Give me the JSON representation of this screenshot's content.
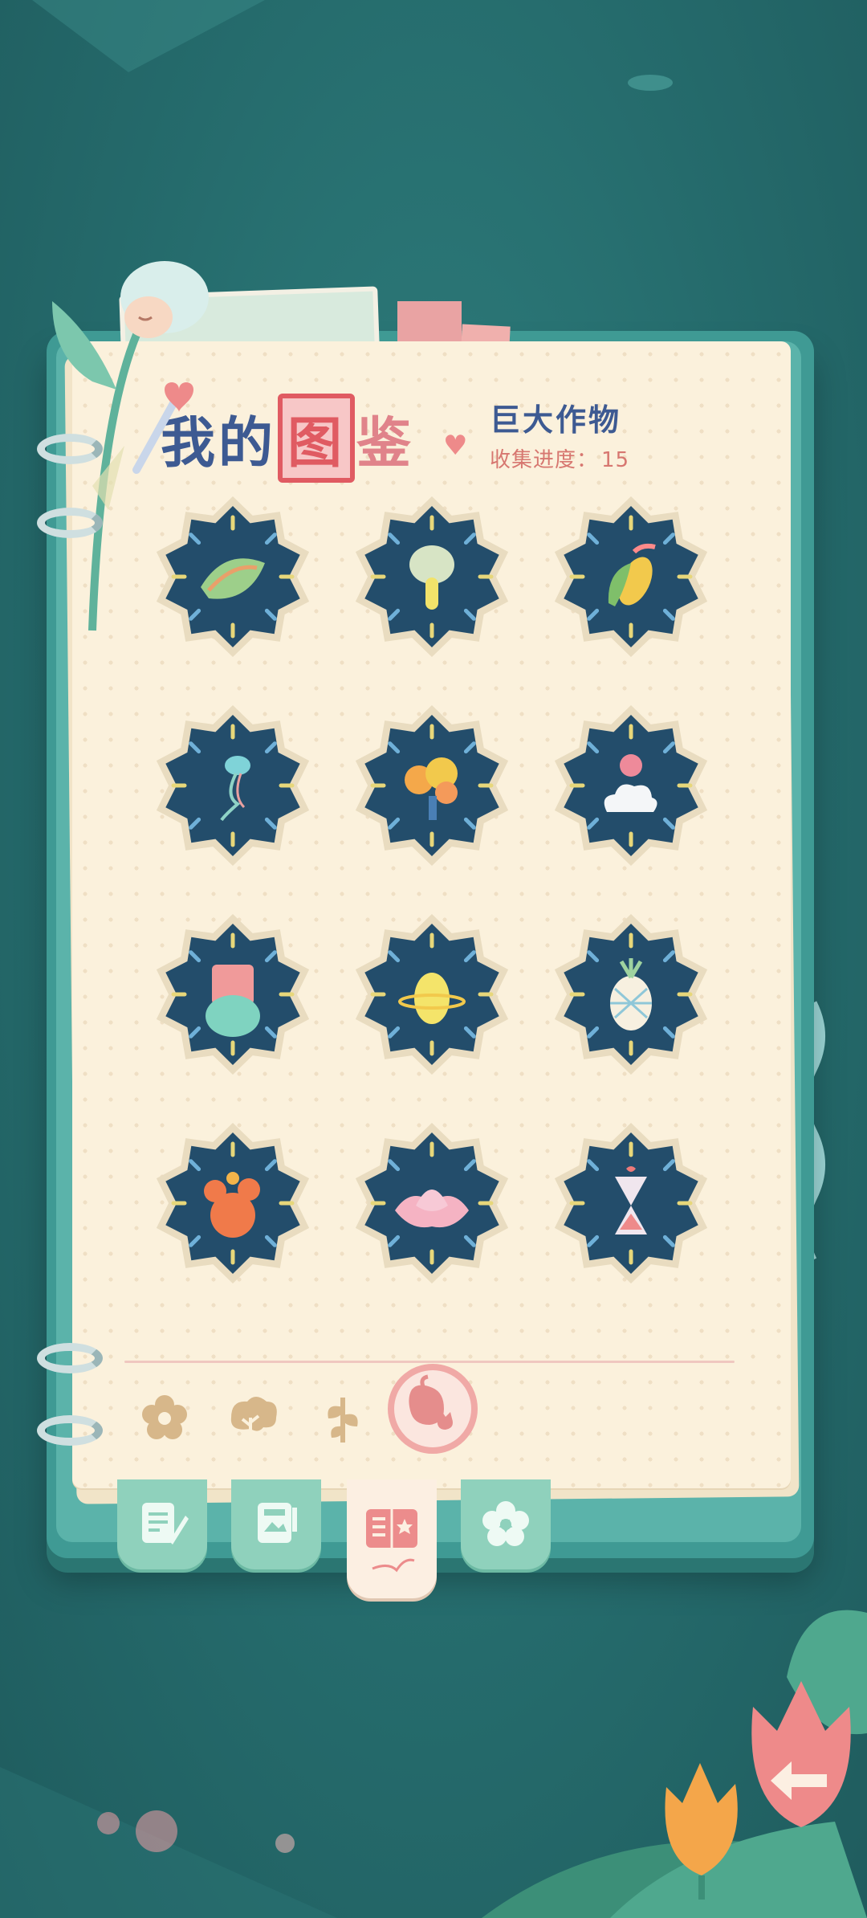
{
  "header": {
    "title_part1": "我的",
    "title_boxed": "图",
    "title_part2": "鉴",
    "category_name": "巨大作物",
    "progress_label": "收集进度：",
    "progress_value": "15"
  },
  "collection": {
    "items": [
      {
        "name": "leaf-bundle-icon"
      },
      {
        "name": "glowing-mushroom-icon"
      },
      {
        "name": "rainbow-corn-icon"
      },
      {
        "name": "jellyfish-icon"
      },
      {
        "name": "coral-tree-icon"
      },
      {
        "name": "cloud-lamp-icon"
      },
      {
        "name": "pink-vase-icon"
      },
      {
        "name": "saturn-hive-icon"
      },
      {
        "name": "crystal-pineapple-icon"
      },
      {
        "name": "cactus-icon"
      },
      {
        "name": "lotus-flower-icon"
      },
      {
        "name": "hourglass-icon"
      }
    ]
  },
  "category_tabs": [
    {
      "name": "flower-category-icon"
    },
    {
      "name": "tree-category-icon"
    },
    {
      "name": "sprout-category-icon"
    },
    {
      "name": "giant-crop-category-icon"
    }
  ],
  "bottom_tabs": [
    {
      "name": "notes-tab-icon"
    },
    {
      "name": "album-tab-icon"
    },
    {
      "name": "collection-book-tab-icon"
    },
    {
      "name": "flower-tab-icon"
    }
  ],
  "colors": {
    "background": "#256b6c",
    "page": "#fbf1dc",
    "badge_dark": "#234d6b",
    "title_blue": "#3d5a92",
    "accent_red": "#e05b62"
  }
}
